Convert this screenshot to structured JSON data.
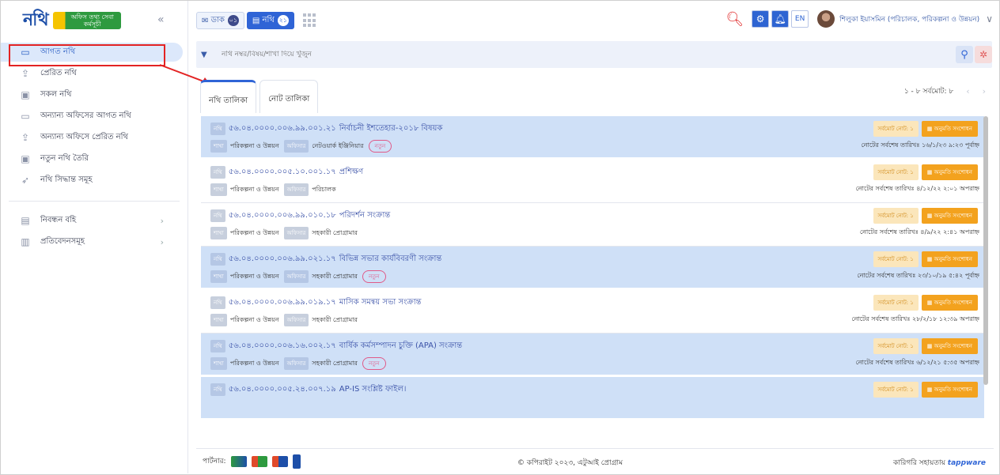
{
  "app": {
    "logo_text": "নথি",
    "logo_badge": "অফিস তথ্য সেবা কর্মসূচী"
  },
  "sidebar": {
    "items": [
      {
        "label": "আগত নথি",
        "icon": "inbox-icon"
      },
      {
        "label": "প্রেরিত নথি",
        "icon": "outbox-icon"
      },
      {
        "label": "সকল নথি",
        "icon": "folder-icon"
      },
      {
        "label": "অন্যান্য অফিসের আগত নথি",
        "icon": "inbox-icon"
      },
      {
        "label": "অন্যান্য অফিসে প্রেরিত নথি",
        "icon": "outbox-icon"
      },
      {
        "label": "নতুন নথি তৈরি",
        "icon": "plus-icon"
      },
      {
        "label": "নথি সিদ্ধান্ত সমূহ",
        "icon": "gavel-icon"
      }
    ],
    "bottom": [
      {
        "label": "নিবন্ধন বহি",
        "icon": "book-icon"
      },
      {
        "label": "প্রতিবেদনসমূহ",
        "icon": "report-icon"
      }
    ]
  },
  "topbar": {
    "dak_label": "ডাক",
    "dak_count": "০১",
    "nothi_label": "নথি",
    "nothi_count": "২১",
    "lang": "EN",
    "user_name": "শিলুকা ইয়াসমিন (পরিচালক, পরিকল্পনা ও উন্নয়ন)"
  },
  "search": {
    "placeholder": "নথি নম্বর/বিষয়/শাখা দিয়ে খুঁজুন"
  },
  "tabs": [
    "নথি তালিকা",
    "নোট তালিকা"
  ],
  "pager": {
    "text": "১ - ৮ সর্বমোট: ৮"
  },
  "labels": {
    "nothi": "নথি",
    "shakha": "শাখা",
    "officer": "অফিসার",
    "new": "নতুন",
    "note_count": "সর্বমোট নোট: ১",
    "permission": "অনুমতি সংশোধন"
  },
  "files": [
    {
      "no": "৫৬.০৪.০০০০.০০৬.৯৯.০০১.২১",
      "subject": "নির্বাচনী ইশতেহার-২০১৮ বিষয়ক",
      "branch": "পরিকল্পনা ও উন্নয়ন",
      "officer": "নেটওয়ার্ক ইঞ্জিনিয়ার",
      "is_new": true,
      "date": "নোটের সর্বশেষ তারিখঃ ১৬/১/২৩ ৯:২৩ পূর্বাহ্ন",
      "highlight": true
    },
    {
      "no": "৫৬.০৪.০০০০.০০৫.১০.০০১.১৭",
      "subject": "প্রশিক্ষণ",
      "branch": "পরিকল্পনা ও উন্নয়ন",
      "officer": "পরিচালক",
      "is_new": false,
      "date": "নোটের সর্বশেষ তারিখঃ ৪/১২/২২ ২:০১ অপরাহ্ন",
      "highlight": false
    },
    {
      "no": "৫৬.০৪.০০০০.০০৬.৯৯.০১০.১৮",
      "subject": "পরিদর্শন সংক্রান্ত",
      "branch": "পরিকল্পনা ও উন্নয়ন",
      "officer": "সহকারী প্রোগ্রামার",
      "is_new": false,
      "date": "নোটের সর্বশেষ তারিখঃ ৪/৯/২২ ২:৪১ অপরাহ্ন",
      "highlight": false
    },
    {
      "no": "৫৬.০৪.০০০০.০০৬.৯৯.০২১.১৭",
      "subject": "বিভিন্ন সভার কার্যবিবরণী সংক্রান্ত",
      "branch": "পরিকল্পনা ও উন্নয়ন",
      "officer": "সহকারী প্রোগ্রামার",
      "is_new": true,
      "date": "নোটের সর্বশেষ তারিখঃ ২৩/১০/১৯ ৫:৪২ পূর্বাহ্ন",
      "highlight": true
    },
    {
      "no": "৫৬.০৪.০০০০.০০৬.৯৯.০১৯.১৭",
      "subject": "মাসিক সমন্বয় সভা সংক্রান্ত",
      "branch": "পরিকল্পনা ও উন্নয়ন",
      "officer": "সহকারী প্রোগ্রামার",
      "is_new": false,
      "date": "নোটের সর্বশেষ তারিখঃ ২৮/২/১৮ ১২:৩৯ অপরাহ্ন",
      "highlight": false
    },
    {
      "no": "৫৬.০৪.০০০০.০০৬.১৬.০০২.১৭",
      "subject": "বার্ষিক কর্মসম্পাদন চুক্তি (APA) সংক্রান্ত",
      "branch": "পরিকল্পনা ও উন্নয়ন",
      "officer": "সহকারী প্রোগ্রামার",
      "is_new": true,
      "date": "নোটের সর্বশেষ তারিখঃ ৬/১২/২১ ৫:৩৫ অপরাহ্ন",
      "highlight": true
    },
    {
      "no": "৫৬.০৪.০০০০.০০৫.২৪.০০৭.১৯",
      "subject": "AP-IS সংশ্লিষ্ট ফাইল।",
      "branch": "",
      "officer": "",
      "is_new": false,
      "date": "",
      "highlight": true
    }
  ],
  "footer": {
    "partners_label": "পার্টনার:",
    "copyright": "© কপিরাইট ২০২৩, এটুআই প্রোগ্রাম",
    "tech_label": "কারিগরি সহায়তায়",
    "tech_brand": "tappware"
  }
}
